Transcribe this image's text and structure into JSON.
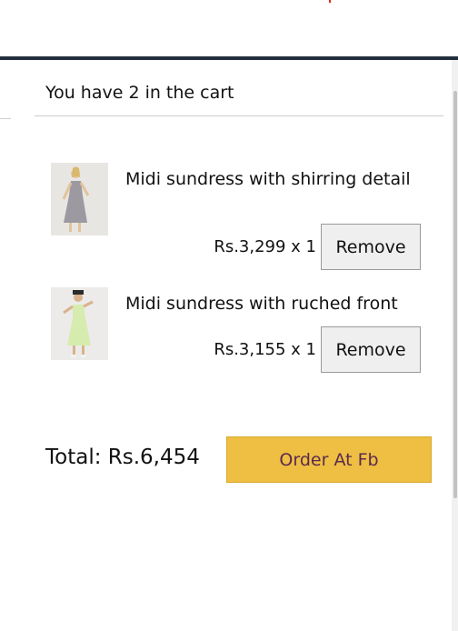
{
  "cart": {
    "header": "You have 2 in the cart",
    "items": [
      {
        "title": "Midi sundress with shirring detail",
        "price_qty": "Rs.3,299 x 1",
        "remove_label": "Remove",
        "thumb_icon": "dress-photo-icon",
        "dress_color": "#9c99a1"
      },
      {
        "title": "Midi sundress with ruched front",
        "price_qty": "Rs.3,155 x 1",
        "remove_label": "Remove",
        "thumb_icon": "dress-photo-icon",
        "dress_color": "#d6ecae"
      }
    ],
    "total": "Total: Rs.6,454",
    "order_label": "Order At Fb"
  },
  "colors": {
    "top_bar": "#232f3e",
    "order_button": "#eebf42",
    "order_text": "#5b2a4e",
    "remove_button": "#efefef"
  }
}
